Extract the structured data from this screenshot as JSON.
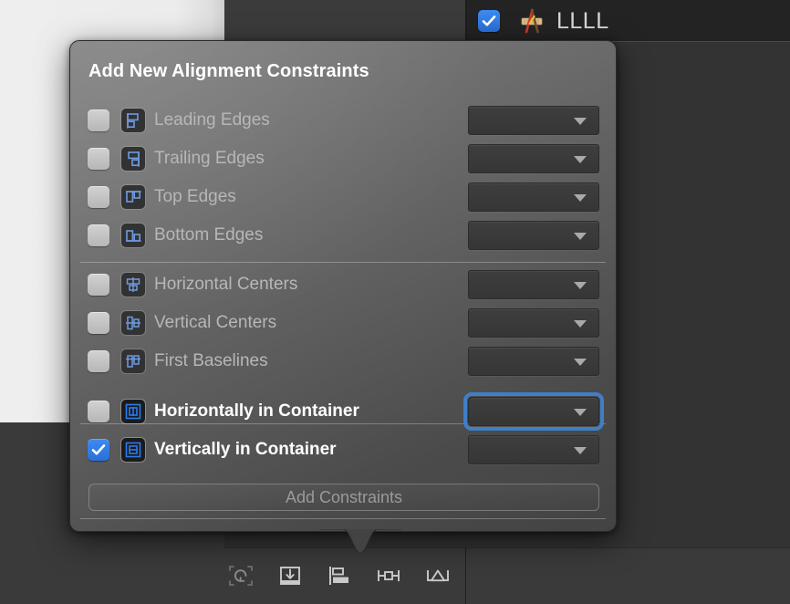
{
  "inspector": {
    "checkbox_checked": true,
    "checkbox_icon": "checkmark-icon",
    "app_icon": "xcode-icon",
    "label": "LLLL"
  },
  "popover": {
    "title": "Add New Alignment Constraints",
    "accent_color": "#3d8bf2",
    "focus_ring_color": "#3f7fc4",
    "groups": [
      {
        "rows": [
          {
            "label": "Leading Edges",
            "checked": false,
            "icon": "align-leading-edges-icon",
            "dropdown": {
              "value": "",
              "caret": "chevron-down-icon",
              "focused": false
            }
          },
          {
            "label": "Trailing Edges",
            "checked": false,
            "icon": "align-trailing-edges-icon",
            "dropdown": {
              "value": "",
              "caret": "chevron-down-icon",
              "focused": false
            }
          },
          {
            "label": "Top Edges",
            "checked": false,
            "icon": "align-top-edges-icon",
            "dropdown": {
              "value": "",
              "caret": "chevron-down-icon",
              "focused": false
            }
          },
          {
            "label": "Bottom Edges",
            "checked": false,
            "icon": "align-bottom-edges-icon",
            "dropdown": {
              "value": "",
              "caret": "chevron-down-icon",
              "focused": false
            }
          }
        ]
      },
      {
        "rows": [
          {
            "label": "Horizontal Centers",
            "checked": false,
            "icon": "align-horizontal-centers-icon",
            "dropdown": {
              "value": "",
              "caret": "chevron-down-icon",
              "focused": false
            }
          },
          {
            "label": "Vertical Centers",
            "checked": false,
            "icon": "align-vertical-centers-icon",
            "dropdown": {
              "value": "",
              "caret": "chevron-down-icon",
              "focused": false
            }
          },
          {
            "label": "First Baselines",
            "checked": false,
            "icon": "align-first-baselines-icon",
            "dropdown": {
              "value": "",
              "caret": "chevron-down-icon",
              "focused": false
            }
          }
        ]
      },
      {
        "rows": [
          {
            "label": "Horizontally in Container",
            "checked": false,
            "icon": "center-horizontally-in-container-icon",
            "dropdown": {
              "value": "",
              "caret": "chevron-down-icon",
              "focused": true
            }
          },
          {
            "label": "Vertically in Container",
            "checked": true,
            "icon": "center-vertically-in-container-icon",
            "dropdown": {
              "value": "",
              "caret": "chevron-down-icon",
              "focused": false
            }
          }
        ]
      }
    ],
    "add_button": {
      "label": "Add Constraints",
      "enabled": false
    }
  },
  "bottom_toolbar": {
    "items": [
      {
        "name": "update-frames-icon",
        "title": "Update Frames"
      },
      {
        "name": "embed-in-stack-icon",
        "title": "Embed In"
      },
      {
        "name": "align-icon",
        "title": "Align"
      },
      {
        "name": "add-new-constraints-icon",
        "title": "Add New Constraints"
      },
      {
        "name": "resolve-auto-layout-issues-icon",
        "title": "Resolve Auto Layout Issues"
      }
    ]
  }
}
